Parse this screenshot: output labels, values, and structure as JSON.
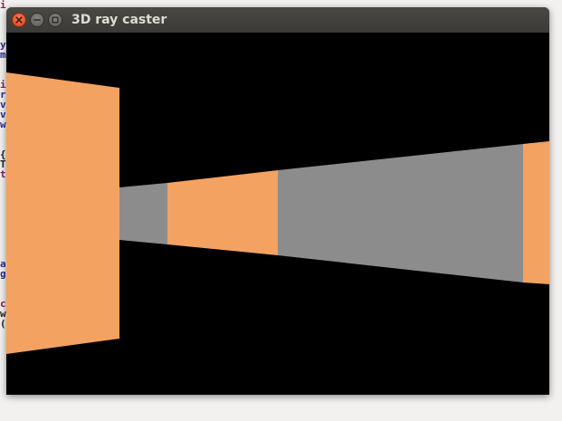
{
  "window": {
    "title": "3D ray caster"
  },
  "titlebar_buttons": {
    "close": "close-icon",
    "minimize": "minimize-icon",
    "maximize": "maximize-icon"
  },
  "scene": {
    "background_color": "#000000",
    "wall_colors": {
      "orange": "#f4a261",
      "gray": "#8c8c8c"
    }
  }
}
